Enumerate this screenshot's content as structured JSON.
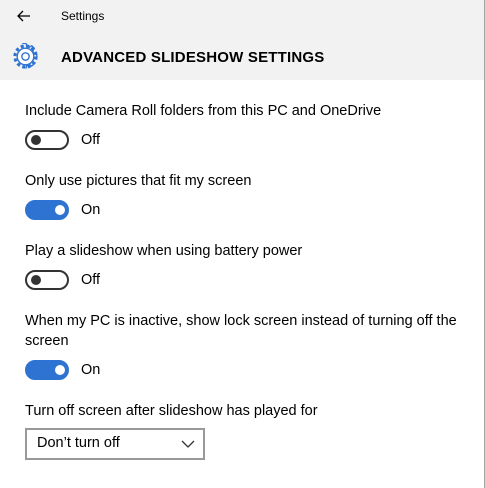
{
  "window": {
    "title": "Settings"
  },
  "header": {
    "title": "ADVANCED SLIDESHOW SETTINGS",
    "icon": "gear-icon"
  },
  "settings": [
    {
      "label": "Include Camera Roll folders from this PC and OneDrive",
      "state": "Off",
      "on": false
    },
    {
      "label": "Only use pictures that fit my screen",
      "state": "On",
      "on": true
    },
    {
      "label": "Play a slideshow when using battery power",
      "state": "Off",
      "on": false
    },
    {
      "label": "When my PC is inactive, show lock screen instead of turning off the screen",
      "state": "On",
      "on": true
    }
  ],
  "screen_off": {
    "label": "Turn off screen after slideshow has played for",
    "value": "Don’t turn off"
  },
  "colors": {
    "accent": "#2e72d2",
    "header_bg": "#f2f2f2"
  }
}
